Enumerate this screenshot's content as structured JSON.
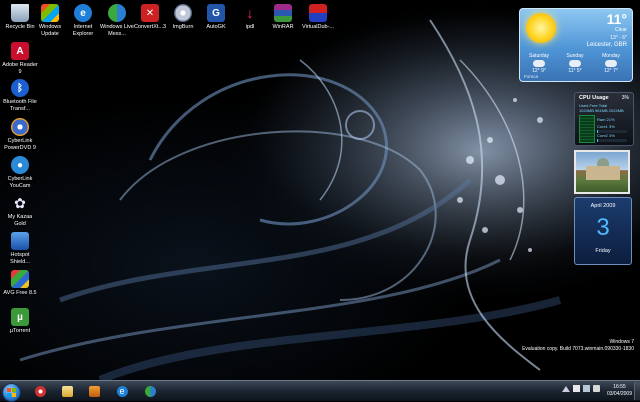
{
  "desktop_icons": [
    {
      "label": "Recycle Bin"
    },
    {
      "label": "Windows Update"
    },
    {
      "label": "Internet Explorer"
    },
    {
      "label": "Windows Live Mess..."
    },
    {
      "label": "ConvertXt...3"
    },
    {
      "label": "ImgBurn"
    },
    {
      "label": "AutoGK"
    },
    {
      "label": "ipdl"
    },
    {
      "label": "WinRAR"
    },
    {
      "label": "VirtualDub-..."
    },
    {
      "label": "Adobe Reader 9"
    },
    {
      "label": "Bluetooth File Transf..."
    },
    {
      "label": "CyberLink PowerDVD 9"
    },
    {
      "label": "CyberLink YouCam"
    },
    {
      "label": "My Kazaa Gold"
    },
    {
      "label": "Hotspot Shield..."
    },
    {
      "label": "AVG Free 8.5"
    },
    {
      "label": "µTorrent"
    }
  ],
  "weather": {
    "temperature": "11°",
    "condition": "Clear",
    "range": "13° - 6°",
    "location": "Leicester, GBR",
    "forecast": [
      {
        "day": "Saturday",
        "hi": "12°",
        "lo": "9°"
      },
      {
        "day": "Sunday",
        "hi": "11°",
        "lo": "5°"
      },
      {
        "day": "Monday",
        "hi": "12°",
        "lo": "7°"
      }
    ],
    "source": "Foreca"
  },
  "cpu": {
    "title": "CPU Usage",
    "percent": "3%",
    "rows": [
      "Used  Free  Total",
      "1024MB 961MB 2024MB",
      "Ram  21%",
      "Core1  3%",
      "Core2  3%"
    ],
    "core1_level": 0.03,
    "core2_level": 0.03
  },
  "calendar": {
    "month": "April 2009",
    "day": "3",
    "weekday": "Friday"
  },
  "watermark": {
    "line1": "Windows 7",
    "line2": "Evaluation copy. Build 7073.winmain.090330-1830"
  },
  "taskbar": {
    "time": "16:55",
    "date": "03/04/2009",
    "pinned": [
      "windows-media-player",
      "windows-explorer",
      "media-player",
      "internet-explorer",
      "windows-live-messenger"
    ]
  }
}
